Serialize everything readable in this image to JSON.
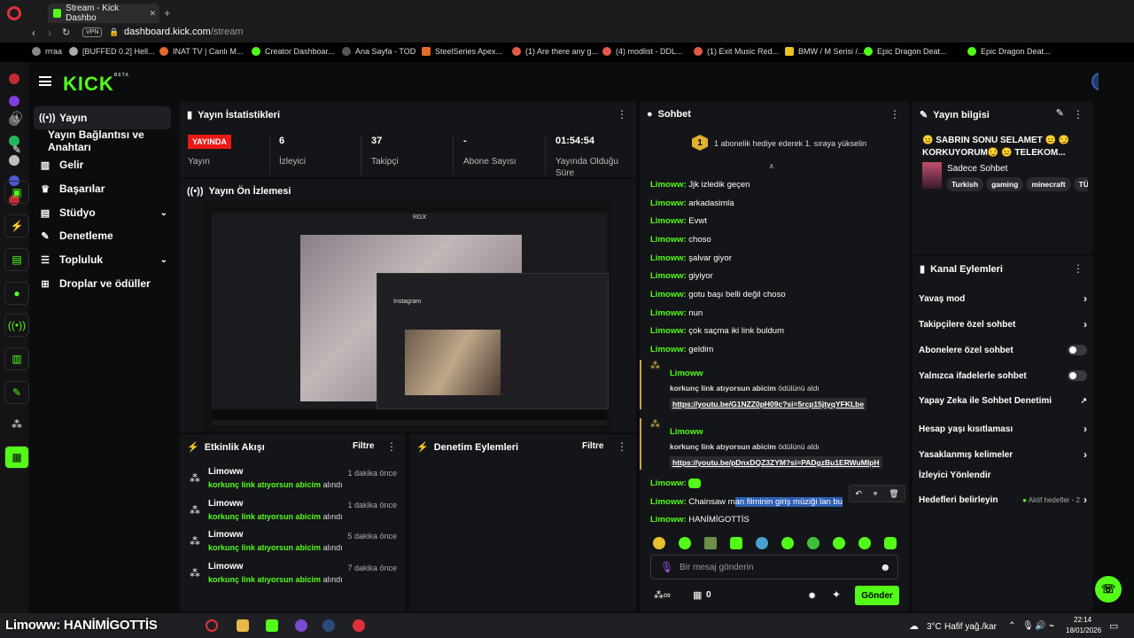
{
  "browser": {
    "tab_title": "Stream - Kick Dashbo",
    "url_domain": "dashboard.kick.com",
    "url_path": "/stream",
    "vpn_label": "VPN",
    "bookmarks": [
      "rrraa",
      "[BUFFED 0.2] Hell...",
      "INAT TV | Canlı M...",
      "Creator Dashboar...",
      "Ana Sayfa - TOD",
      "SteelSeries Apex...",
      "(1) Are there any g...",
      "(4) modlist - DDL...",
      "(1) Exit Music Red...",
      "BMW / M Serisi /...",
      "Epic Dragon Deat...",
      "Epic Dragon Deat..."
    ]
  },
  "brand": {
    "logo": "KICK",
    "beta": "BETA",
    "accent": "#53fc18"
  },
  "nav": {
    "items": [
      {
        "label": "Yayın",
        "icon": "broadcast-icon"
      },
      {
        "label": "Yayın Bağlantısı ve Anahtarı",
        "icon": ""
      },
      {
        "label": "Gelir",
        "icon": "chart-icon"
      },
      {
        "label": "Başarılar",
        "icon": "trophy-icon"
      },
      {
        "label": "Stüdyo",
        "icon": "studio-icon"
      },
      {
        "label": "Denetleme",
        "icon": "wrench-icon"
      },
      {
        "label": "Topluluk",
        "icon": "people-icon"
      },
      {
        "label": "Droplar ve ödüller",
        "icon": "gift-icon"
      }
    ]
  },
  "stats": {
    "title": "Yayın İstatistikleri",
    "live_badge": "YAYINDA",
    "items": [
      {
        "label": "Yayın",
        "value": ""
      },
      {
        "label": "İzleyici",
        "value": "6"
      },
      {
        "label": "Takipçi",
        "value": "37"
      },
      {
        "label": "Abone Sayısı",
        "value": "-"
      },
      {
        "label": "Yayında Olduğu Süre",
        "value": "01:54:54"
      }
    ]
  },
  "preview": {
    "title": "Yayın Ön İzlemesi",
    "overlay_label": "RGX",
    "insta_label": "Instagram"
  },
  "activity": {
    "title": "Etkinlik Akışı",
    "filter": "Filtre",
    "items": [
      {
        "user": "Limoww",
        "reward": "korkunç link atıyorsun abicim",
        "suffix": "alındı",
        "time": "1 dakika önce"
      },
      {
        "user": "Limoww",
        "reward": "korkunç link atıyorsun abicim",
        "suffix": "alındı",
        "time": "1 dakika önce"
      },
      {
        "user": "Limoww",
        "reward": "korkunç link atıyorsun abicim",
        "suffix": "alındı",
        "time": "5 dakika önce"
      },
      {
        "user": "Limoww",
        "reward": "korkunç link atıyorsun abicim",
        "suffix": "alındı",
        "time": "7 dakika önce"
      }
    ]
  },
  "moderation": {
    "title": "Denetim Eylemleri",
    "filter": "Filtre"
  },
  "chat": {
    "title": "Sohbet",
    "banner_num": "1",
    "banner": "1 abonelik hediye ederek 1. sıraya yükselin",
    "messages": [
      {
        "user": "Limoww:",
        "text": "Jjk izledik geçen"
      },
      {
        "user": "Limoww:",
        "text": "arkadasimla"
      },
      {
        "user": "Limoww:",
        "text": "Evwt"
      },
      {
        "user": "Limoww:",
        "text": "choso"
      },
      {
        "user": "Limoww:",
        "text": "şalvar giyor"
      },
      {
        "user": "Limoww:",
        "text": "giyiyor"
      },
      {
        "user": "Limoww:",
        "text": "gotu başı belli değil choso"
      },
      {
        "user": "Limoww:",
        "text": "nun"
      },
      {
        "user": "Limoww:",
        "text": "çok saçma iki link buldum"
      },
      {
        "user": "Limoww:",
        "text": "geldim"
      }
    ],
    "gifts": [
      {
        "user": "Limoww",
        "reward": "korkunç link atıyorsun abicim",
        "suffix": "ödülünü aldı",
        "link": "https://youtu.be/G1NZZ0pH09c?si=5rcp15jtyqYFKLbe"
      },
      {
        "user": "Limoww",
        "reward": "korkunç link atıyorsun abicim",
        "suffix": "ödülünü aldı",
        "link": "https://youtu.be/pDnxDQZ3ZYM?si=PADgzBu1ERWuMlpH"
      }
    ],
    "tail": [
      {
        "user": "Limoww:",
        "text": ""
      },
      {
        "user": "Limoww:",
        "text_pre": "Chainsaw m",
        "text_sel": "an filminin giriş müziği lan bu"
      },
      {
        "user": "Limoww:",
        "text": "HANİMİGOTTİS"
      }
    ],
    "input_placeholder": "Bir mesaj gönderin",
    "points": "0",
    "send_label": "Gönder"
  },
  "stream_info": {
    "title": "Yayın bilgisi",
    "stream_title": "😐 SABRIN SONU SELAMET 😐 😏 KORKUYORUM😏 😐 TELEKOM...",
    "category": "Sadece Sohbet",
    "tags": [
      "Turkish",
      "gaming",
      "minecraft",
      "TÜ"
    ]
  },
  "channel_actions": {
    "title": "Kanal Eylemleri",
    "rows": [
      {
        "label": "Yavaş mod",
        "type": "chevron"
      },
      {
        "label": "Takipçilere özel sohbet",
        "type": "chevron"
      },
      {
        "label": "Abonelere özel sohbet",
        "type": "toggle"
      },
      {
        "label": "Yalnızca ifadelerle sohbet",
        "type": "toggle"
      },
      {
        "label": "Yapay Zeka ile Sohbet Denetimi",
        "type": "external"
      },
      {
        "label": "Hesap yaşı kısıtlaması",
        "type": "chevron"
      },
      {
        "label": "Yasaklanmış kelimeler",
        "type": "chevron"
      },
      {
        "label": "İzleyici Yönlendir",
        "type": "none"
      },
      {
        "label": "Hedefleri belirleyin",
        "type": "goal"
      }
    ],
    "goal_status": "Aktif hedefler - 2"
  },
  "taskbar": {
    "overlay": "Limoww: HANİMİGOTTİS",
    "weather_temp": "3°C",
    "weather_text": "Hafif yağ./kar",
    "time": "22:14",
    "date": "18/01/2026"
  }
}
